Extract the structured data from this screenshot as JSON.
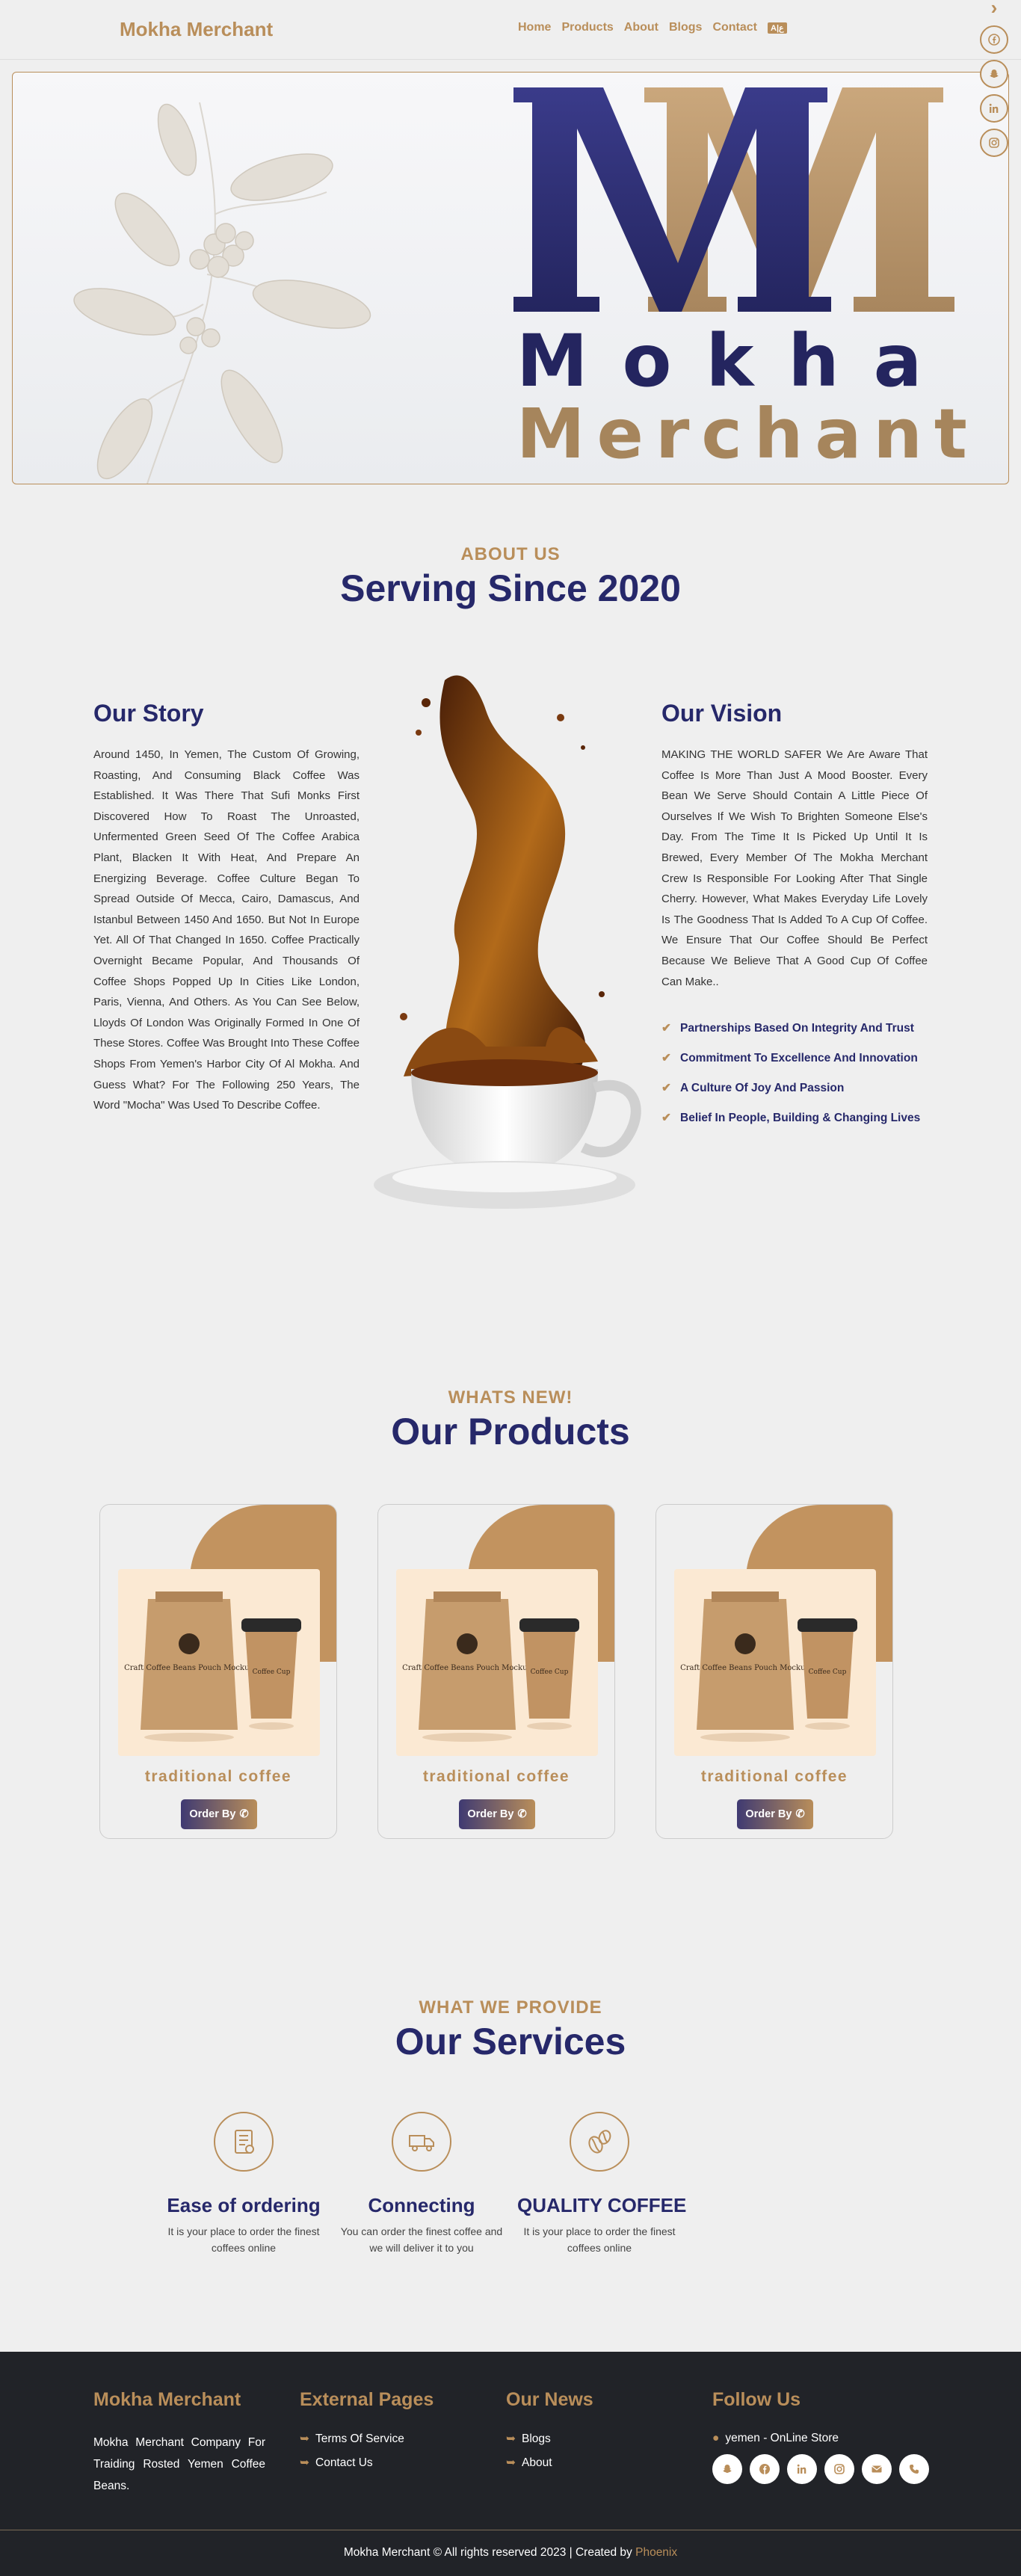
{
  "nav": {
    "brand": "Mokha Merchant",
    "links": [
      "Home",
      "Products",
      "About",
      "Blogs",
      "Contact"
    ],
    "lang_icon": "A",
    "lang_icon2": "ع"
  },
  "side_social": [
    "facebook-icon",
    "snapchat-icon",
    "linkedin-icon",
    "instagram-icon"
  ],
  "hero": {
    "word1": "Mokha",
    "word2": "Merchant"
  },
  "about": {
    "subtitle": "ABOUT US",
    "title": "Serving Since 2020",
    "story_title": "Our Story",
    "story_text": "Around 1450, In Yemen, The Custom Of Growing, Roasting, And Consuming Black Coffee Was Established. It Was There That Sufi Monks First Discovered How To Roast The Unroasted, Unfermented Green Seed Of The Coffee Arabica Plant, Blacken It With Heat, And Prepare An Energizing Beverage. Coffee Culture Began To Spread Outside Of Mecca, Cairo, Damascus, And Istanbul Between 1450 And 1650. But Not In Europe Yet. All Of That Changed In 1650. Coffee Practically Overnight Became Popular, And Thousands Of Coffee Shops Popped Up In Cities Like London, Paris, Vienna, And Others. As You Can See Below, Lloyds Of London Was Originally Formed In One Of These Stores. Coffee Was Brought Into These Coffee Shops From Yemen's Harbor City Of Al Mokha. And Guess What? For The Following 250 Years, The Word \"Mocha\" Was Used To Describe Coffee.",
    "vision_title": "Our Vision",
    "vision_text": "MAKING THE WORLD SAFER We Are Aware That Coffee Is More Than Just A Mood Booster. Every Bean We Serve Should Contain A Little Piece Of Ourselves If We Wish To Brighten Someone Else's Day. From The Time It Is Picked Up Until It Is Brewed, Every Member Of The Mokha Merchant Crew Is Responsible For Looking After That Single Cherry. However, What Makes Everyday Life Lovely Is The Goodness That Is Added To A Cup Of Coffee. We Ensure That Our Coffee Should Be Perfect Because We Believe That A Good Cup Of Coffee Can Make..",
    "vision_points": [
      "Partnerships Based On Integrity And Trust",
      "Commitment To Excellence And Innovation",
      "A Culture Of Joy And Passion",
      "Belief In People, Building & Changing Lives"
    ]
  },
  "products": {
    "subtitle": "WHATS NEW!",
    "title": "Our Products",
    "items": [
      {
        "name": "traditional coffee",
        "button": "Order By",
        "pouch": "Craft Coffee Beans Pouch Mockup",
        "cup": "Coffee Cup"
      },
      {
        "name": "traditional coffee",
        "button": "Order By",
        "pouch": "Craft Coffee Beans Pouch Mockup",
        "cup": "Coffee Cup"
      },
      {
        "name": "traditional coffee",
        "button": "Order By",
        "pouch": "Craft Coffee Beans Pouch Mockup",
        "cup": "Coffee Cup"
      }
    ]
  },
  "services": {
    "subtitle": "WHAT WE PROVIDE",
    "title": "Our Services",
    "items": [
      {
        "title": "Ease of ordering",
        "text": "It is your place to order the finest coffees online",
        "icon": "menu-card-icon"
      },
      {
        "title": "Connecting",
        "text": "You can order the finest coffee and we will deliver it to you",
        "icon": "delivery-truck-icon"
      },
      {
        "title": "QUALITY COFFEE",
        "text": "It is your place to order the finest coffees online",
        "icon": "coffee-beans-icon"
      }
    ]
  },
  "footer": {
    "col1_title": "Mokha Merchant",
    "col1_text": "Mokha Merchant Company For Traiding Rosted Yemen Coffee Beans.",
    "col2_title": "External Pages",
    "col2_links": [
      "Terms Of Service",
      "Contact Us"
    ],
    "col3_title": "Our News",
    "col3_links": [
      "Blogs",
      "About"
    ],
    "col4_title": "Follow Us",
    "location": "yemen - OnLine Store",
    "social": [
      "snapchat-icon",
      "facebook-icon",
      "linkedin-icon",
      "instagram-icon",
      "email-icon",
      "phone-icon"
    ],
    "copyright": "Mokha Merchant © All rights reserved 2023 | Created by",
    "creator": "Phoenix"
  },
  "colors": {
    "gold": "#b98e5a",
    "navy": "#26286a",
    "footer_bg": "#212328"
  }
}
